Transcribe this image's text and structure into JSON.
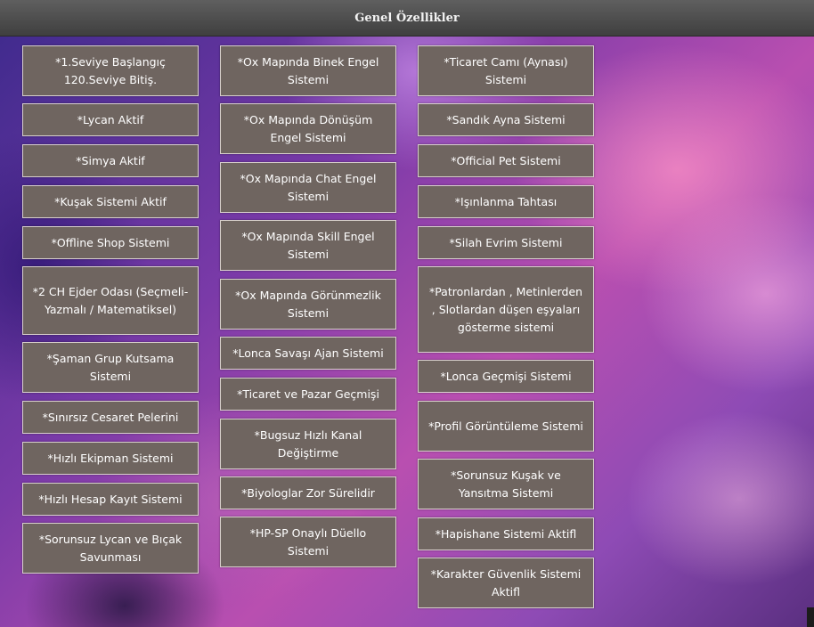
{
  "title": "Genel Özellikler",
  "columns": [
    [
      "*1.Seviye Başlangıç 120.Seviye Bitiş.",
      "*Lycan Aktif",
      "*Simya Aktif",
      "*Kuşak Sistemi Aktif",
      "*Offline Shop Sistemi",
      "*2 CH Ejder Odası (Seçmeli-Yazmalı / Matematiksel)",
      "*Şaman Grup Kutsama Sistemi",
      "*Sınırsız Cesaret Pelerini",
      "*Hızlı Ekipman Sistemi",
      "*Hızlı Hesap Kayıt Sistemi",
      "*Sorunsuz Lycan ve Bıçak Savunması"
    ],
    [
      "*Ox Mapında Binek Engel Sistemi",
      "*Ox Mapında Dönüşüm Engel Sistemi",
      "*Ox Mapında Chat Engel Sistemi",
      "*Ox Mapında Skill Engel Sistemi",
      "*Ox Mapında Görünmezlik Sistemi",
      "*Lonca Savaşı Ajan Sistemi",
      "*Ticaret ve Pazar Geçmişi",
      "*Bugsuz Hızlı Kanal Değiştirme",
      "*Biyologlar Zor Sürelidir",
      "*HP-SP Onaylı Düello Sistemi"
    ],
    [
      "*Ticaret Camı (Aynası) Sistemi",
      "*Sandık Ayna Sistemi",
      "*Official Pet Sistemi",
      "*Işınlanma Tahtası",
      "*Silah Evrim Sistemi",
      "*Patronlardan , Metinlerden , Slotlardan düşen eşyaları gösterme sistemi",
      "*Lonca Geçmişi Sistemi",
      "*Profil Görüntüleme Sistemi",
      "*Sorunsuz Kuşak ve Yansıtma Sistemi",
      "*Hapishane Sistemi Aktifl",
      "*Karakter Güvenlik Sistemi Aktifl"
    ]
  ]
}
